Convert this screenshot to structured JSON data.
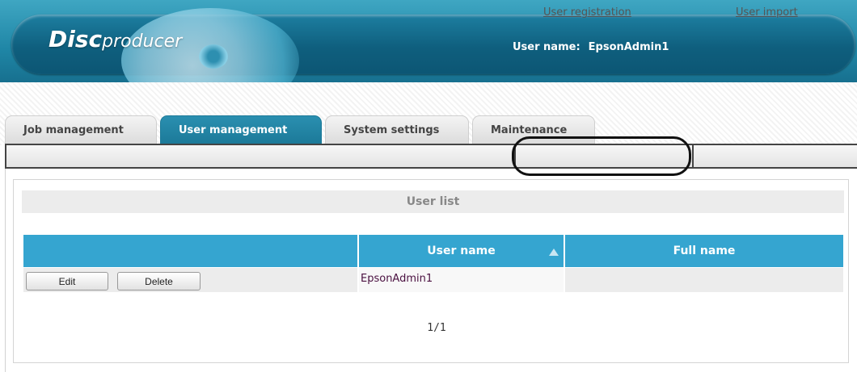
{
  "header": {
    "logo_disc": "Disc",
    "logo_producer": "producer",
    "user_name_label": "User name:",
    "user_name_value": "EpsonAdmin1"
  },
  "tabs": [
    {
      "label": "Job management",
      "active": false
    },
    {
      "label": "User management",
      "active": true
    },
    {
      "label": "System settings",
      "active": false
    },
    {
      "label": "Maintenance",
      "active": false
    }
  ],
  "subnav": {
    "registration": "User registration",
    "import": "User import"
  },
  "user_list": {
    "title": "User list",
    "columns": [
      "",
      "User name",
      "Full name"
    ],
    "sorted_by": "User name",
    "sort_direction": "ascending",
    "rows": [
      {
        "edit_label": "Edit",
        "delete_label": "Delete",
        "user_name": "EpsonAdmin1",
        "full_name": ""
      }
    ],
    "pager": "1/1"
  },
  "colors": {
    "header": "#1d7fa1",
    "active_tab": "#2a8fb0",
    "table_header": "#35a5d0"
  }
}
